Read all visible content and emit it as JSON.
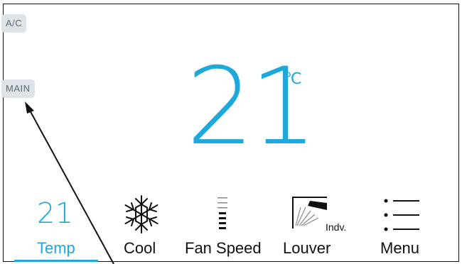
{
  "mode_labels": {
    "ac": "A/C",
    "main": "MAIN"
  },
  "display": {
    "temperature": "21",
    "unit": "℃"
  },
  "tabs": [
    {
      "label": "Temp",
      "value": "21"
    },
    {
      "label": "Cool"
    },
    {
      "label": "Fan Speed"
    },
    {
      "label": "Louver",
      "sub": "Indv."
    },
    {
      "label": "Menu"
    }
  ],
  "icons": {
    "cool": "snowflake-icon",
    "fan_speed": "fan-speed-icon",
    "louver": "louver-icon",
    "menu": "menu-list-icon"
  },
  "colors": {
    "accent": "#1ea8dc",
    "pill_bg": "#dde3e6",
    "pill_text": "#5d6b73"
  }
}
